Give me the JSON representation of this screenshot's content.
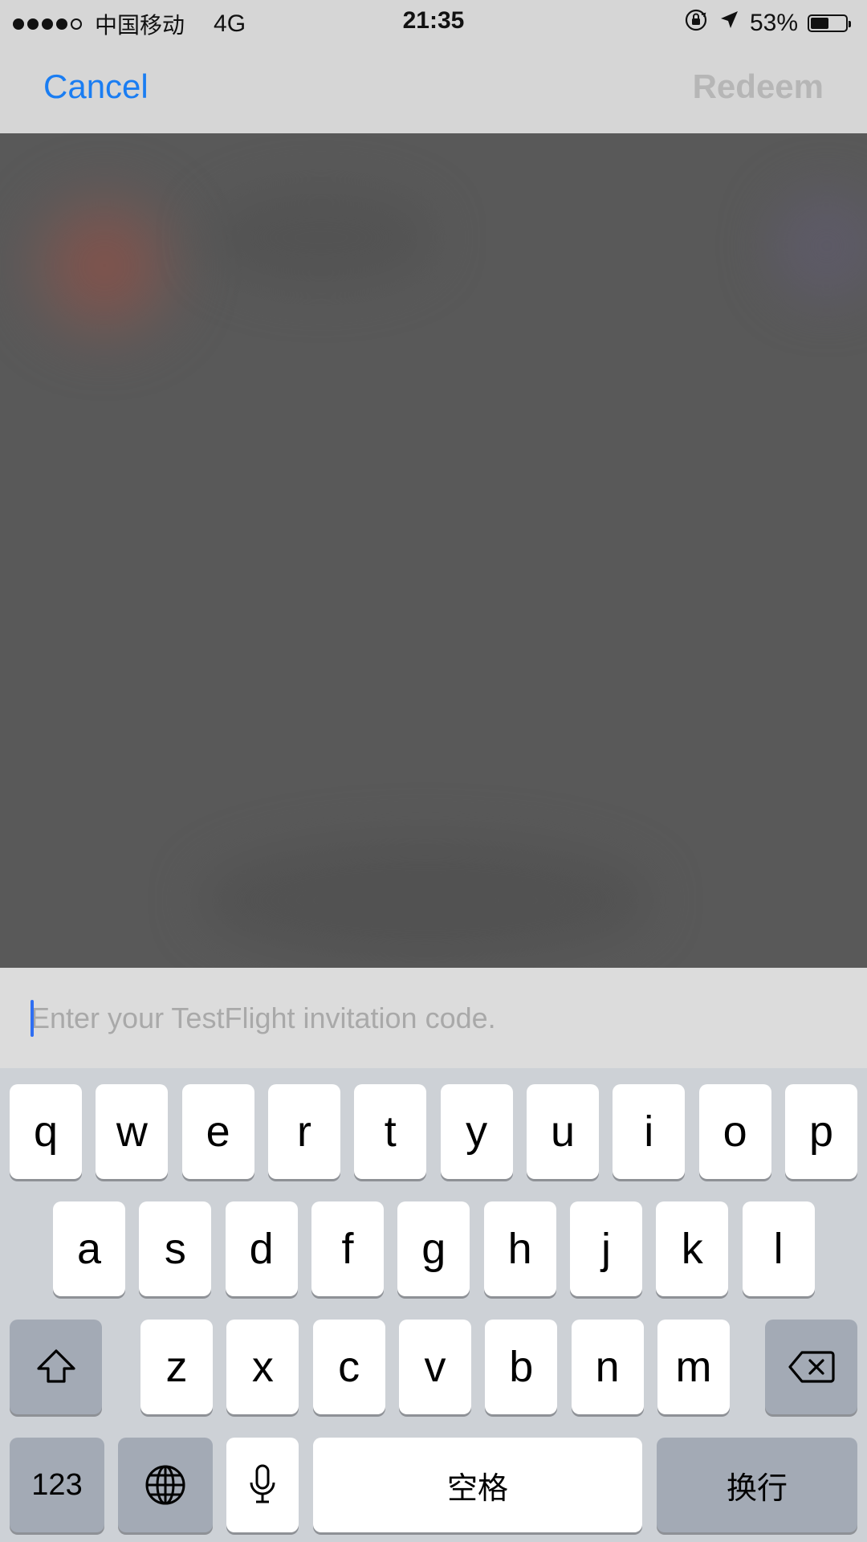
{
  "status_bar": {
    "carrier": "中国移动",
    "network": "4G",
    "time": "21:35",
    "battery_percent": "53%",
    "battery_level": 0.53,
    "signal_bars_filled": 4,
    "signal_bars_total": 5
  },
  "nav": {
    "cancel_label": "Cancel",
    "redeem_label": "Redeem"
  },
  "input": {
    "placeholder": "Enter your TestFlight invitation code.",
    "value": ""
  },
  "keyboard": {
    "row1": [
      "q",
      "w",
      "e",
      "r",
      "t",
      "y",
      "u",
      "i",
      "o",
      "p"
    ],
    "row2": [
      "a",
      "s",
      "d",
      "f",
      "g",
      "h",
      "j",
      "k",
      "l"
    ],
    "row3": [
      "z",
      "x",
      "c",
      "v",
      "b",
      "n",
      "m"
    ],
    "numbers_label": "123",
    "space_label": "空格",
    "return_label": "换行"
  },
  "colors": {
    "accent": "#1a7df2",
    "disabled": "#b6b6b6",
    "cursor": "#2e6ef2"
  },
  "icons": {
    "shift": "shift-icon",
    "delete": "delete-icon",
    "globe": "globe-icon",
    "microphone": "microphone-icon",
    "orientation_lock": "orientation-lock-icon",
    "location": "location-arrow-icon"
  }
}
